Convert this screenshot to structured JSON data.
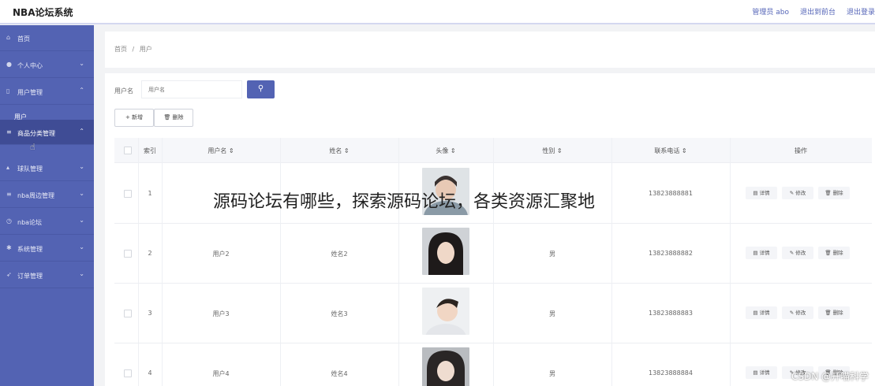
{
  "header": {
    "title": "NBA论坛系统",
    "links": [
      "管理员 abo",
      "退出到前台",
      "退出登录"
    ]
  },
  "sidebar": {
    "items": [
      {
        "label": "首页",
        "icon": "home-icon",
        "arrow": ""
      },
      {
        "label": "个人中心",
        "icon": "user-icon",
        "arrow": "⌄"
      },
      {
        "label": "用户管理",
        "icon": "doc-icon",
        "arrow": "⌃"
      },
      {
        "label": "商品分类管理",
        "icon": "list-icon",
        "arrow": "⌃"
      },
      {
        "label": "球队管理",
        "icon": "chart-icon",
        "arrow": "⌄"
      },
      {
        "label": "nba周边管理",
        "icon": "list-icon",
        "arrow": "⌄"
      },
      {
        "label": "nba论坛",
        "icon": "clock-icon",
        "arrow": "⌄"
      },
      {
        "label": "系统管理",
        "icon": "gear-icon",
        "arrow": "⌄"
      },
      {
        "label": "订单管理",
        "icon": "send-icon",
        "arrow": "⌄"
      }
    ],
    "sub_item": "用户"
  },
  "breadcrumb": {
    "home": "首页",
    "sep": "/",
    "current": "用户"
  },
  "search": {
    "label": "用户名",
    "placeholder": "用户名"
  },
  "buttons": {
    "add": "+ 新增",
    "delete": "🗑 删除"
  },
  "table": {
    "headers": [
      "索引",
      "用户名 ⇕",
      "姓名 ⇕",
      "头像 ⇕",
      "性别 ⇕",
      "联系电话 ⇕",
      "操作"
    ],
    "rows": [
      {
        "index": "1",
        "username": "",
        "name": "",
        "gender": "",
        "phone": "13823888881"
      },
      {
        "index": "2",
        "username": "用户2",
        "name": "姓名2",
        "gender": "男",
        "phone": "13823888882"
      },
      {
        "index": "3",
        "username": "用户3",
        "name": "姓名3",
        "gender": "男",
        "phone": "13823888883"
      },
      {
        "index": "4",
        "username": "用户4",
        "name": "姓名4",
        "gender": "男",
        "phone": "13823888884"
      }
    ],
    "actions": {
      "detail": "详情",
      "edit": "修改",
      "remove": "删除"
    }
  },
  "overlay_text": "源码论坛有哪些，探索源码论坛，各类资源汇聚地",
  "watermark": "CSDN @开喵科学",
  "colors": {
    "accent": "#5363b3",
    "active": "#3f4c95"
  }
}
